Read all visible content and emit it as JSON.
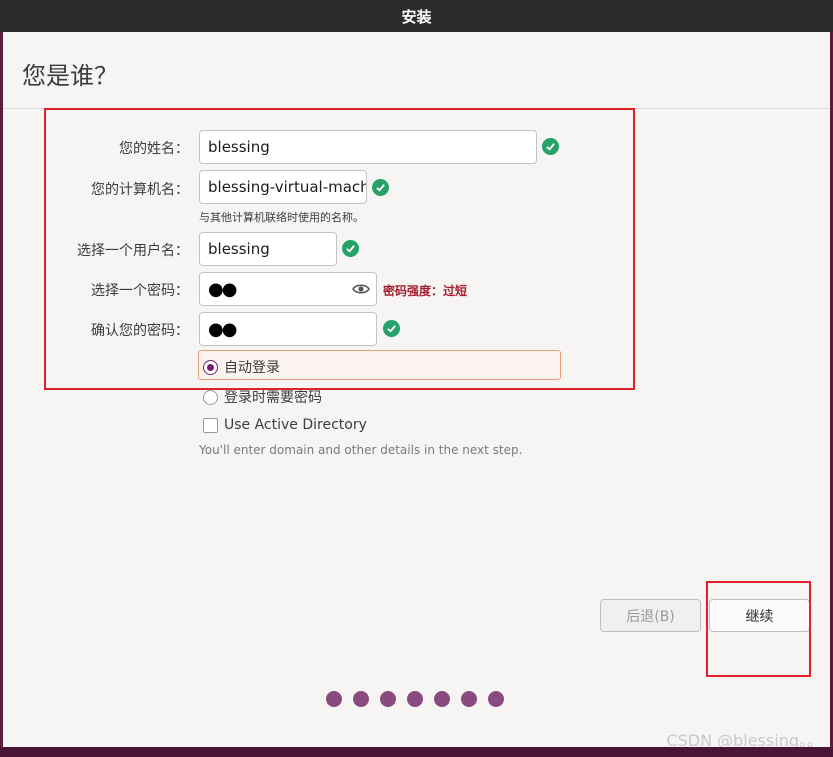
{
  "titlebar": {
    "title": "安装"
  },
  "page": {
    "title": "您是谁？"
  },
  "form": {
    "name_label": "您的姓名：",
    "name_value": "blessing",
    "computer_label": "您的计算机名：",
    "computer_value": "blessing-virtual-machine",
    "computer_hint": "与其他计算机联络时使用的名称。",
    "username_label": "选择一个用户名：",
    "username_value": "blessing",
    "password_label": "选择一个密码：",
    "password_value": "●●",
    "password_strength": "密码强度：过短",
    "confirm_label": "确认您的密码：",
    "confirm_value": "●●",
    "login_options": [
      {
        "label": "自动登录",
        "selected": true
      },
      {
        "label": "登录时需要密码",
        "selected": false
      }
    ],
    "active_directory_label": "Use Active Directory",
    "active_directory_checked": false,
    "active_directory_note": "You'll enter domain and other details in the next step."
  },
  "buttons": {
    "back_label": "后退(B)",
    "continue_label": "继续"
  },
  "progress": {
    "total_steps": 7,
    "color": "#8b4a7f"
  },
  "watermark": "CSDN @blessing。。",
  "icons": {
    "valid": "check-circle-icon",
    "reveal": "eye-icon"
  },
  "colors": {
    "valid_green": "#26a269",
    "accent_purple": "#77216f",
    "strength_red": "#a51d2d",
    "annotation_red": "#e0202a"
  }
}
